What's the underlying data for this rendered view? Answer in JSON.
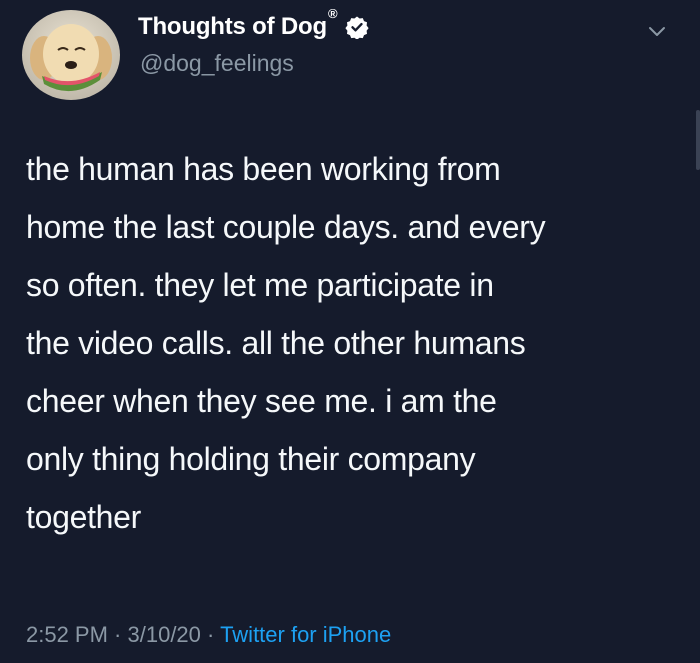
{
  "user": {
    "display_name": "Thoughts of Dog",
    "reg_mark": "®",
    "handle": "@dog_feelings"
  },
  "icons": {
    "avatar": "dog-with-watermelon-avatar",
    "verified": "verified-badge-icon",
    "menu": "chevron-down-icon"
  },
  "tweet": {
    "lines": [
      "the human has been working from",
      "home the last couple days. and every",
      "so often. they let me participate in",
      "the video calls. all the other humans",
      "cheer when they see me. i am the",
      "only thing holding their company",
      "together"
    ]
  },
  "meta": {
    "time": "2:52 PM",
    "sep1": " · ",
    "date": "3/10/20",
    "sep2": " · ",
    "source": "Twitter for iPhone"
  },
  "colors": {
    "background": "#151b2c",
    "text": "#f5f8fa",
    "secondary": "#8b98a5",
    "link": "#1da1f2"
  }
}
